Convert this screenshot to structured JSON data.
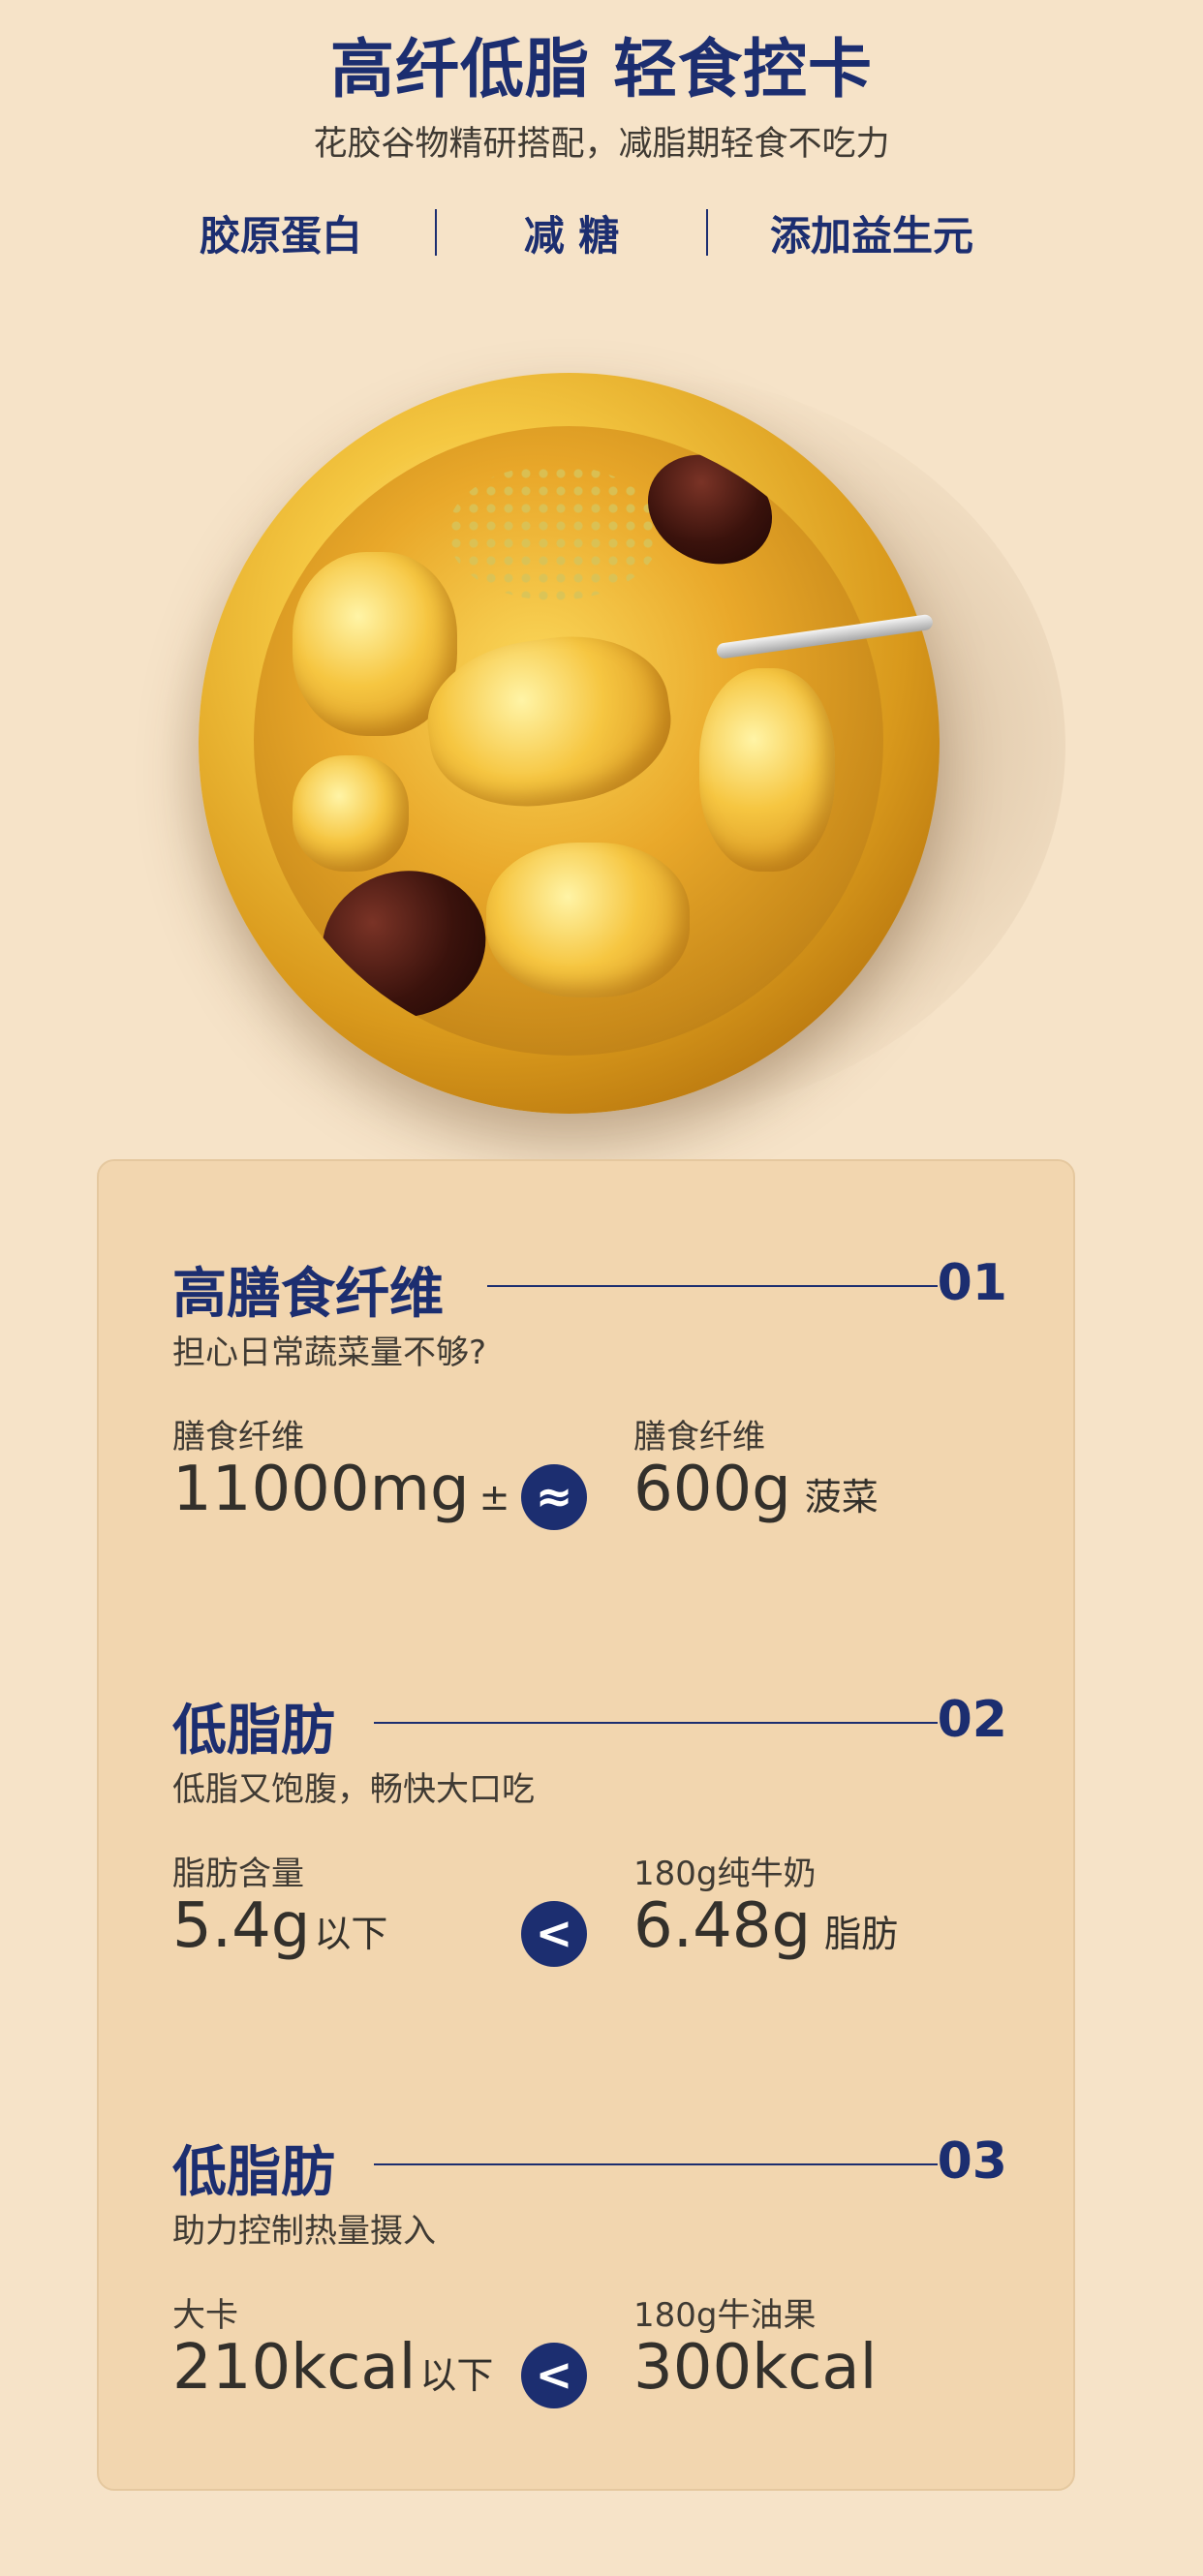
{
  "header": {
    "title": "高纤低脂 轻食控卡",
    "subtitle": "花胶谷物精研搭配，减脂期轻食不吃力",
    "features": [
      "胶原蛋白",
      "减 糖",
      "添加益生元"
    ]
  },
  "sections": [
    {
      "title": "高膳食纤维",
      "number": "01",
      "subtitle": "担心日常蔬菜量不够?",
      "left_label": "膳食纤维",
      "left_value": "11000mg",
      "left_suffix": "±",
      "symbol": "≈",
      "right_label": "膳食纤维",
      "right_value": "600g",
      "right_suffix": "菠菜"
    },
    {
      "title": "低脂肪",
      "number": "02",
      "subtitle": "低脂又饱腹，畅快大口吃",
      "left_label": "脂肪含量",
      "left_value": "5.4g",
      "left_suffix": "以下",
      "symbol": "<",
      "right_label": "180g纯牛奶",
      "right_value": "6.48g",
      "right_suffix": "脂肪"
    },
    {
      "title": "低脂肪",
      "number": "03",
      "subtitle": "助力控制热量摄入",
      "left_label": "大卡",
      "left_value": "210kcal",
      "left_suffix": "以下",
      "symbol": "<",
      "right_label": "180g牛油果",
      "right_value": "300kcal",
      "right_suffix": ""
    }
  ],
  "colors": {
    "background": "#f6e3c8",
    "card": "#f2d6af",
    "accent_navy": "#1c2e70",
    "text": "#3f3a33"
  },
  "icons": {
    "product_image": "bowl-of-fish-maw-soup-with-red-dates"
  }
}
